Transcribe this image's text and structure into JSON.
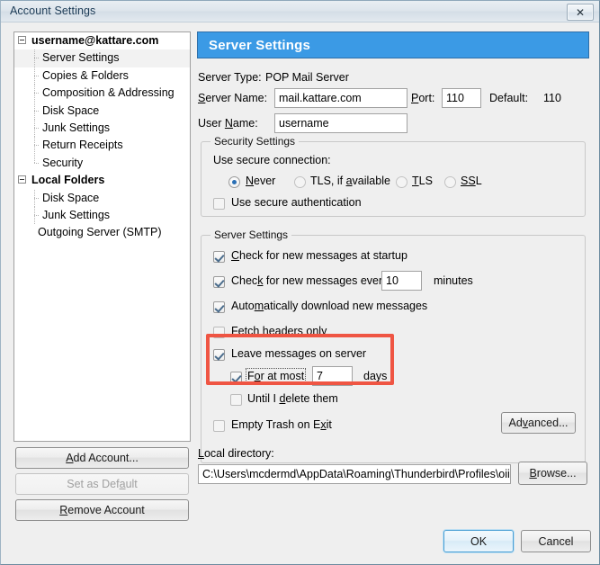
{
  "window": {
    "title": "Account Settings",
    "close_icon": "close-icon",
    "close_glyph": "✕"
  },
  "colors": {
    "header_blue": "#3b9ae5",
    "highlight_red": "#ef5543",
    "check_blue": "#4a6c8c",
    "radio_blue": "#2a6fb5"
  },
  "tree": {
    "nodes": [
      {
        "label": "username@kattare.com",
        "level": 0,
        "expander": "minus",
        "selected": false,
        "bold": true
      },
      {
        "label": "Server Settings",
        "level": 1,
        "expander": "none",
        "selected": true,
        "bold": false
      },
      {
        "label": "Copies & Folders",
        "level": 1,
        "expander": "none",
        "selected": false,
        "bold": false
      },
      {
        "label": "Composition & Addressing",
        "level": 1,
        "expander": "none",
        "selected": false,
        "bold": false
      },
      {
        "label": "Disk Space",
        "level": 1,
        "expander": "none",
        "selected": false,
        "bold": false
      },
      {
        "label": "Junk Settings",
        "level": 1,
        "expander": "none",
        "selected": false,
        "bold": false
      },
      {
        "label": "Return Receipts",
        "level": 1,
        "expander": "none",
        "selected": false,
        "bold": false
      },
      {
        "label": "Security",
        "level": 1,
        "expander": "none",
        "selected": false,
        "bold": false
      },
      {
        "label": "Local Folders",
        "level": 0,
        "expander": "minus",
        "selected": false,
        "bold": false
      },
      {
        "label": "Disk Space",
        "level": 1,
        "expander": "none",
        "selected": false,
        "bold": false
      },
      {
        "label": "Junk Settings",
        "level": 1,
        "expander": "none",
        "selected": false,
        "bold": false
      },
      {
        "label": "Outgoing Server (SMTP)",
        "level": 1,
        "expander": "none",
        "selected": false,
        "bold": false
      }
    ]
  },
  "account_buttons": {
    "add_account": "Add Account...",
    "set_as_default": "Set as Default",
    "remove_account": "Remove Account",
    "set_as_default_disabled": true
  },
  "pane": {
    "title": "Server Settings",
    "server_type_label": "Server Type:",
    "server_type_value": "POP Mail Server",
    "server_name_label": "Server Name:",
    "server_name_value": "mail.kattare.com",
    "port_label": "Port:",
    "port_value": "110",
    "default_label": "Default:",
    "default_value": "110",
    "user_name_label": "User Name:",
    "user_name_value": "username"
  },
  "security_settings": {
    "group_title": "Security Settings",
    "use_secure_connection_label": "Use secure connection:",
    "radios": [
      {
        "label": "Never",
        "selected": true
      },
      {
        "label": "TLS, if available",
        "selected": false
      },
      {
        "label": "TLS",
        "selected": false
      },
      {
        "label": "SSL",
        "selected": false
      }
    ],
    "secure_auth_label": "Use secure authentication",
    "secure_auth_checked": false
  },
  "server_settings": {
    "group_title": "Server Settings",
    "check_startup_label": "Check for new messages at startup",
    "check_startup_checked": true,
    "check_every_label": "Check for new messages every",
    "check_every_checked": true,
    "check_every_value": "10",
    "minutes_label": "minutes",
    "auto_download_label": "Automatically download new messages",
    "auto_download_checked": true,
    "fetch_headers_label": "Fetch headers only",
    "fetch_headers_checked": false,
    "leave_messages_label": "Leave messages on server",
    "leave_messages_checked": true,
    "for_at_most_label": "For at most",
    "for_at_most_checked": true,
    "for_at_most_value": "7",
    "days_label": "days",
    "until_delete_label": "Until I delete them",
    "until_delete_checked": false,
    "empty_trash_label": "Empty Trash on Exit",
    "empty_trash_checked": false,
    "advanced_button": "Advanced..."
  },
  "local_directory": {
    "label": "Local directory:",
    "value": "C:\\Users\\mcdermd\\AppData\\Roaming\\Thunderbird\\Profiles\\oii",
    "browse_button": "Browse..."
  },
  "dialog_buttons": {
    "ok": "OK",
    "cancel": "Cancel"
  }
}
